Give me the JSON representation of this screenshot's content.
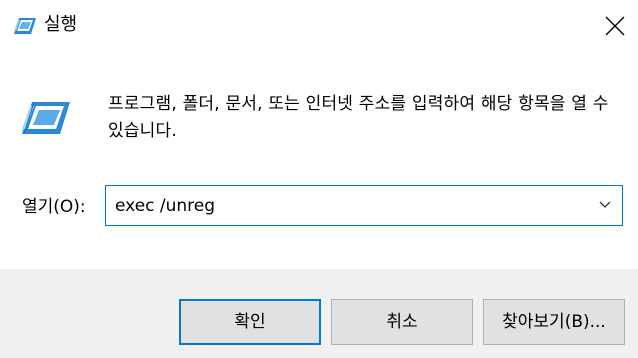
{
  "window": {
    "title": "실행",
    "title_icon": "run-icon",
    "close_icon": "close-icon"
  },
  "body": {
    "icon": "run-icon",
    "description": "프로그램, 폴더, 문서, 또는 인터넷 주소를 입력하여 해당 항목을 열 수 있습니다.",
    "open_label": "열기(O):",
    "open_value": "exec /unreg",
    "dropdown_icon": "chevron-down-icon"
  },
  "buttons": {
    "ok": "확인",
    "cancel": "취소",
    "browse": "찾아보기(B)..."
  },
  "colors": {
    "accent": "#0078d7",
    "footer_bg": "#f0f0f0",
    "button_bg": "#e1e1e1"
  }
}
